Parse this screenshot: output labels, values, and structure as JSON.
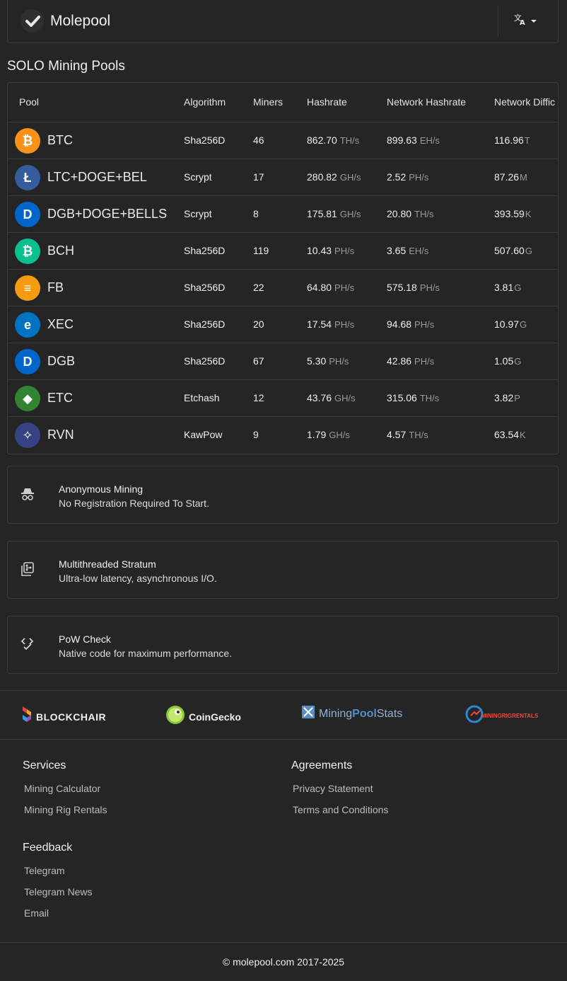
{
  "nav": {
    "brand": "Molepool",
    "lang_icon": "translate-icon"
  },
  "section_title": "SOLO Mining Pools",
  "table": {
    "headers": [
      "Pool",
      "Algorithm",
      "Miners",
      "Hashrate",
      "Network Hashrate",
      "Network Diffic"
    ],
    "rows": [
      {
        "name": "BTC",
        "icon": "bitcoin-icon",
        "color": "#f7931a",
        "glyph": "₿",
        "algorithm": "Sha256D",
        "miners": "46",
        "hashrate": "862.70",
        "hashrate_unit": "TH/s",
        "net_hashrate": "899.63",
        "net_hashrate_unit": "EH/s",
        "difficulty": "116.96",
        "difficulty_unit": "T"
      },
      {
        "name": "LTC+DOGE+BEL",
        "icon": "litecoin-icon",
        "color": "#345d9d",
        "glyph": "Ł",
        "algorithm": "Scrypt",
        "miners": "17",
        "hashrate": "280.82",
        "hashrate_unit": "GH/s",
        "net_hashrate": "2.52",
        "net_hashrate_unit": "PH/s",
        "difficulty": "87.26",
        "difficulty_unit": "M"
      },
      {
        "name": "DGB+DOGE+BELLS",
        "icon": "digibyte-icon",
        "color": "#0066cc",
        "glyph": "D",
        "algorithm": "Scrypt",
        "miners": "8",
        "hashrate": "175.81",
        "hashrate_unit": "GH/s",
        "net_hashrate": "20.80",
        "net_hashrate_unit": "TH/s",
        "difficulty": "393.59",
        "difficulty_unit": "K"
      },
      {
        "name": "BCH",
        "icon": "bitcoin-cash-icon",
        "color": "#0ac18e",
        "glyph": "₿",
        "algorithm": "Sha256D",
        "miners": "119",
        "hashrate": "10.43",
        "hashrate_unit": "PH/s",
        "net_hashrate": "3.65",
        "net_hashrate_unit": "EH/s",
        "difficulty": "507.60",
        "difficulty_unit": "G"
      },
      {
        "name": "FB",
        "icon": "fractal-bitcoin-icon",
        "color": "#f39c12",
        "glyph": "≡",
        "algorithm": "Sha256D",
        "miners": "22",
        "hashrate": "64.80",
        "hashrate_unit": "PH/s",
        "net_hashrate": "575.18",
        "net_hashrate_unit": "PH/s",
        "difficulty": "3.81",
        "difficulty_unit": "G"
      },
      {
        "name": "XEC",
        "icon": "ecash-icon",
        "color": "#0074c2",
        "glyph": "e",
        "algorithm": "Sha256D",
        "miners": "20",
        "hashrate": "17.54",
        "hashrate_unit": "PH/s",
        "net_hashrate": "94.68",
        "net_hashrate_unit": "PH/s",
        "difficulty": "10.97",
        "difficulty_unit": "G"
      },
      {
        "name": "DGB",
        "icon": "digibyte-icon",
        "color": "#0066cc",
        "glyph": "D",
        "algorithm": "Sha256D",
        "miners": "67",
        "hashrate": "5.30",
        "hashrate_unit": "PH/s",
        "net_hashrate": "42.86",
        "net_hashrate_unit": "PH/s",
        "difficulty": "1.05",
        "difficulty_unit": "G"
      },
      {
        "name": "ETC",
        "icon": "ethereum-classic-icon",
        "color": "#328332",
        "glyph": "◆",
        "algorithm": "Etchash",
        "miners": "12",
        "hashrate": "43.76",
        "hashrate_unit": "GH/s",
        "net_hashrate": "315.06",
        "net_hashrate_unit": "TH/s",
        "difficulty": "3.82",
        "difficulty_unit": "P"
      },
      {
        "name": "RVN",
        "icon": "ravencoin-icon",
        "color": "#384182",
        "glyph": "✧",
        "algorithm": "KawPow",
        "miners": "9",
        "hashrate": "1.79",
        "hashrate_unit": "GH/s",
        "net_hashrate": "4.57",
        "net_hashrate_unit": "TH/s",
        "difficulty": "63.54",
        "difficulty_unit": "K"
      }
    ]
  },
  "features": [
    {
      "icon": "incognito-icon",
      "title": "Anonymous Mining",
      "desc": "No Registration Required To Start."
    },
    {
      "icon": "server-threads-icon",
      "title": "Multithreaded Stratum",
      "desc": "Ultra-low latency, asynchronous I/O."
    },
    {
      "icon": "code-check-icon",
      "title": "PoW Check",
      "desc": "Native code for maximum performance."
    }
  ],
  "partners": [
    {
      "name": "BLOCKCHAIR",
      "icon": "blockchair-logo"
    },
    {
      "name": "CoinGecko",
      "icon": "coingecko-logo"
    },
    {
      "name_a": "Mining",
      "name_b": "Pool",
      "name_c": "Stats",
      "icon": "miningpoolstats-logo"
    },
    {
      "name": "MININGRIGRENTALS",
      "icon": "miningrigrentals-logo"
    }
  ],
  "footer": {
    "services": {
      "title": "Services",
      "links": [
        "Mining Calculator",
        "Mining Rig Rentals"
      ]
    },
    "agreements": {
      "title": "Agreements",
      "links": [
        "Privacy Statement",
        "Terms and Conditions"
      ]
    },
    "feedback": {
      "title": "Feedback",
      "links": [
        "Telegram",
        "Telegram News",
        "Email"
      ]
    }
  },
  "copyright": "© molepool.com 2017-2025"
}
